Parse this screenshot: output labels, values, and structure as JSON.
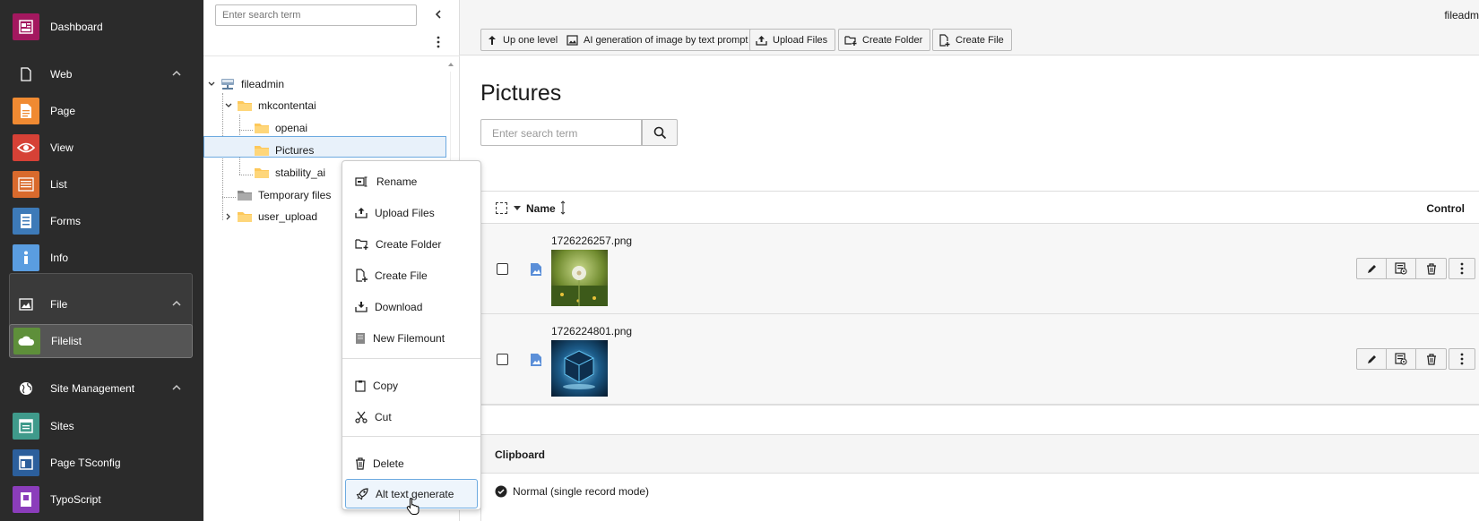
{
  "modules": {
    "dashboard": "Dashboard",
    "web_group": "Web",
    "page": "Page",
    "view": "View",
    "list": "List",
    "forms": "Forms",
    "info": "Info",
    "file_group": "File",
    "filelist": "Filelist",
    "site_group": "Site Management",
    "sites": "Sites",
    "page_tsconfig": "Page TSconfig",
    "typoscript": "TypoScript"
  },
  "tree": {
    "search_placeholder": "Enter search term",
    "nodes": {
      "fileadmin": "fileadmin",
      "mkcontentai": "mkcontentai",
      "openai": "openai",
      "pictures": "Pictures",
      "stability_ai": "stability_ai",
      "temporary": "Temporary files",
      "user_upload": "user_upload"
    }
  },
  "context_menu": {
    "rename": "Rename",
    "upload": "Upload Files",
    "create_folder": "Create Folder",
    "create_file": "Create File",
    "download": "Download",
    "new_filemount": "New Filemount",
    "copy": "Copy",
    "cut": "Cut",
    "delete": "Delete",
    "alt_text": "Alt text generate"
  },
  "toolbar": {
    "user": "fileadm",
    "up_one_level": "Up one level",
    "ai_generation": "AI generation of image by text prompt",
    "upload_files": "Upload Files",
    "create_folder": "Create Folder",
    "create_file": "Create File"
  },
  "main": {
    "title": "Pictures",
    "search_placeholder": "Enter search term",
    "col_name": "Name",
    "col_control": "Control",
    "files": [
      {
        "name": "1726226257.png"
      },
      {
        "name": "1726224801.png"
      }
    ],
    "clipboard_title": "Clipboard",
    "clipboard_mode": "Normal (single record mode)"
  },
  "colors": {
    "dashboard": "#a3185f",
    "page": "#f08a32",
    "view": "#d64136",
    "list": "#d96a2d",
    "forms": "#3d7ab8",
    "info": "#5a9de0",
    "filelist": "#5e8f3a",
    "sites": "#3f9a8b",
    "page_tsconfig": "#2c5f9c",
    "typoscript": "#8b3dbb",
    "folder": "#fdc85a"
  }
}
